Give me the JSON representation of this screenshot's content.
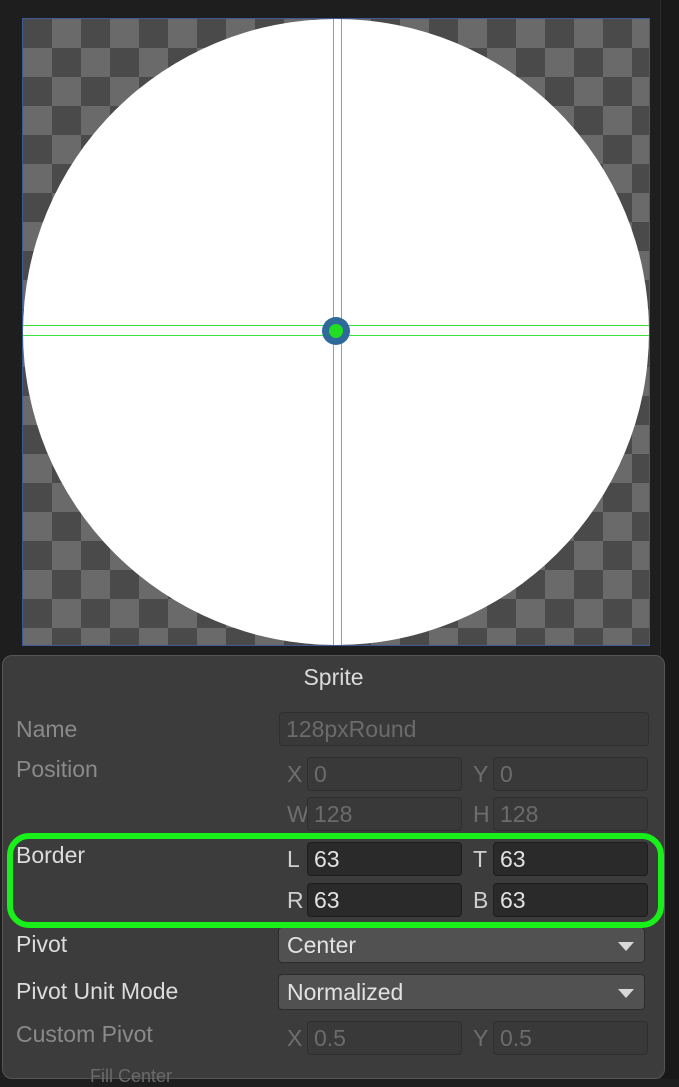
{
  "panel": {
    "title": "Sprite",
    "name": {
      "label": "Name",
      "value": "128pxRound"
    },
    "position": {
      "label": "Position",
      "x": {
        "prefix": "X",
        "value": "0"
      },
      "y": {
        "prefix": "Y",
        "value": "0"
      },
      "w": {
        "prefix": "W",
        "value": "128"
      },
      "h": {
        "prefix": "H",
        "value": "128"
      }
    },
    "border": {
      "label": "Border",
      "l": {
        "prefix": "L",
        "value": "63"
      },
      "t": {
        "prefix": "T",
        "value": "63"
      },
      "r": {
        "prefix": "R",
        "value": "63"
      },
      "b": {
        "prefix": "B",
        "value": "63"
      }
    },
    "pivot": {
      "label": "Pivot",
      "value": "Center"
    },
    "pivot_unit_mode": {
      "label": "Pivot Unit Mode",
      "value": "Normalized"
    },
    "custom_pivot": {
      "label": "Custom Pivot",
      "x": {
        "prefix": "X",
        "value": "0.5"
      },
      "y": {
        "prefix": "Y",
        "value": "0.5"
      }
    },
    "fill_center": {
      "label": "Fill Center"
    }
  },
  "colors": {
    "highlight": "#19f019",
    "guide_lines": "#3dde3d",
    "pivot_handle": "#22dd22"
  }
}
